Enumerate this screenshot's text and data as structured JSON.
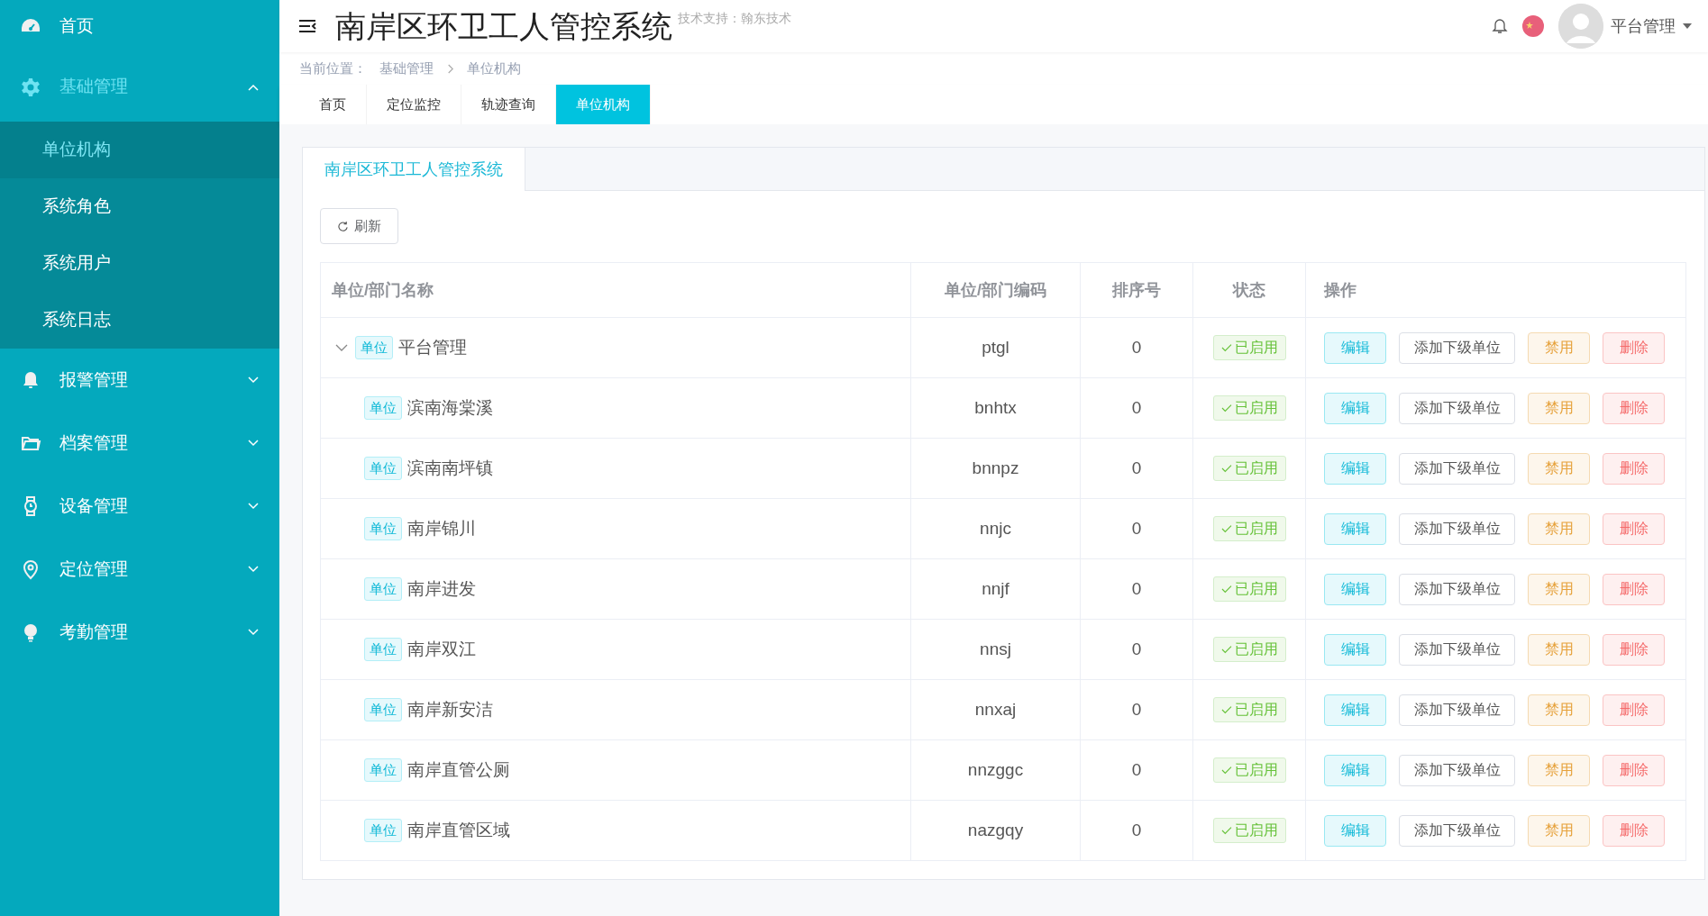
{
  "sidebar": {
    "items": [
      {
        "kind": "link",
        "label": "首页",
        "selected": false
      },
      {
        "kind": "group",
        "label": "基础管理",
        "expanded": true,
        "selected": true,
        "children": [
          {
            "label": "单位机构",
            "selected": true
          },
          {
            "label": "系统角色",
            "selected": false
          },
          {
            "label": "系统用户",
            "selected": false
          },
          {
            "label": "系统日志",
            "selected": false
          }
        ]
      },
      {
        "kind": "group",
        "label": "报警管理",
        "expanded": false,
        "selected": false
      },
      {
        "kind": "group",
        "label": "档案管理",
        "expanded": false,
        "selected": false
      },
      {
        "kind": "group",
        "label": "设备管理",
        "expanded": false,
        "selected": false
      },
      {
        "kind": "group",
        "label": "定位管理",
        "expanded": false,
        "selected": false
      },
      {
        "kind": "group",
        "label": "考勤管理",
        "expanded": false,
        "selected": false
      }
    ]
  },
  "header": {
    "title": "南岸区环卫工人管控系统",
    "support": "技术支持：翰东技术",
    "user": "平台管理"
  },
  "breadcrumb": {
    "label": "当前位置：",
    "items": [
      "基础管理",
      "单位机构"
    ]
  },
  "tabs": [
    {
      "label": "首页",
      "selected": false
    },
    {
      "label": "定位监控",
      "selected": false
    },
    {
      "label": "轨迹查询",
      "selected": false
    },
    {
      "label": "单位机构",
      "selected": true
    }
  ],
  "panel": {
    "tab": "南岸区环卫工人管控系统",
    "refresh": "刷新"
  },
  "table": {
    "columns": [
      "单位/部门名称",
      "单位/部门编码",
      "排序号",
      "状态",
      "操作"
    ],
    "rows": [
      {
        "tag": "单位",
        "name": "平台管理",
        "code": "ptgl",
        "order": "0",
        "status": "已启用",
        "expanded": true,
        "actions": [
          {
            "kind": "edit",
            "label": "编辑"
          },
          {
            "kind": "add",
            "label": "添加下级单位"
          },
          {
            "kind": "disable",
            "label": "禁用"
          },
          {
            "kind": "delete",
            "label": "删除"
          }
        ],
        "children": [
          {
            "tag": "单位",
            "name": "滨南海棠溪",
            "code": "bnhtx",
            "order": "0",
            "status": "已启用",
            "actions": [
              {
                "kind": "edit",
                "label": "编辑"
              },
              {
                "kind": "add",
                "label": "添加下级单位"
              },
              {
                "kind": "disable",
                "label": "禁用"
              },
              {
                "kind": "delete",
                "label": "删除"
              }
            ]
          },
          {
            "tag": "单位",
            "name": "滨南南坪镇",
            "code": "bnnpz",
            "order": "0",
            "status": "已启用",
            "actions": [
              {
                "kind": "edit",
                "label": "编辑"
              },
              {
                "kind": "add",
                "label": "添加下级单位"
              },
              {
                "kind": "disable",
                "label": "禁用"
              },
              {
                "kind": "delete",
                "label": "删除"
              }
            ]
          },
          {
            "tag": "单位",
            "name": "南岸锦川",
            "code": "nnjc",
            "order": "0",
            "status": "已启用",
            "actions": [
              {
                "kind": "edit",
                "label": "编辑"
              },
              {
                "kind": "add",
                "label": "添加下级单位"
              },
              {
                "kind": "disable",
                "label": "禁用"
              },
              {
                "kind": "delete",
                "label": "删除"
              }
            ]
          },
          {
            "tag": "单位",
            "name": "南岸进发",
            "code": "nnjf",
            "order": "0",
            "status": "已启用",
            "actions": [
              {
                "kind": "edit",
                "label": "编辑"
              },
              {
                "kind": "add",
                "label": "添加下级单位"
              },
              {
                "kind": "disable",
                "label": "禁用"
              },
              {
                "kind": "delete",
                "label": "删除"
              }
            ]
          },
          {
            "tag": "单位",
            "name": "南岸双江",
            "code": "nnsj",
            "order": "0",
            "status": "已启用",
            "actions": [
              {
                "kind": "edit",
                "label": "编辑"
              },
              {
                "kind": "add",
                "label": "添加下级单位"
              },
              {
                "kind": "disable",
                "label": "禁用"
              },
              {
                "kind": "delete",
                "label": "删除"
              }
            ]
          },
          {
            "tag": "单位",
            "name": "南岸新安洁",
            "code": "nnxaj",
            "order": "0",
            "status": "已启用",
            "actions": [
              {
                "kind": "edit",
                "label": "编辑"
              },
              {
                "kind": "add",
                "label": "添加下级单位"
              },
              {
                "kind": "disable",
                "label": "禁用"
              },
              {
                "kind": "delete",
                "label": "删除"
              }
            ]
          },
          {
            "tag": "单位",
            "name": "南岸直管公厕",
            "code": "nnzggc",
            "order": "0",
            "status": "已启用",
            "actions": [
              {
                "kind": "edit",
                "label": "编辑"
              },
              {
                "kind": "add",
                "label": "添加下级单位"
              },
              {
                "kind": "disable",
                "label": "禁用"
              },
              {
                "kind": "delete",
                "label": "删除"
              }
            ]
          },
          {
            "tag": "单位",
            "name": "南岸直管区域",
            "code": "nazgqy",
            "order": "0",
            "status": "已启用",
            "actions": [
              {
                "kind": "edit",
                "label": "编辑"
              },
              {
                "kind": "add",
                "label": "添加下级单位"
              },
              {
                "kind": "disable",
                "label": "禁用"
              },
              {
                "kind": "delete",
                "label": "删除"
              }
            ]
          }
        ]
      }
    ]
  }
}
